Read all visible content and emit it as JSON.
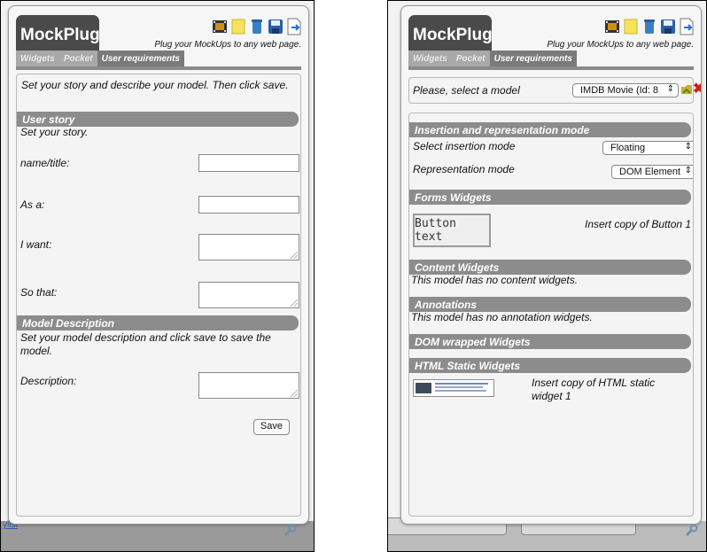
{
  "app": {
    "logo": "MockPlug",
    "tagline": "Plug your MockUps to any web page.",
    "tabs": [
      "Widgets",
      "Pocket",
      "User requirements"
    ]
  },
  "left_panel": {
    "intro": "Set your story and describe your model. Then click save.",
    "user_story": {
      "heading": "User story",
      "subtitle": "Set your story.",
      "fields": [
        {
          "label": "name/title:",
          "value": ""
        },
        {
          "label": "As a:",
          "value": ""
        },
        {
          "label": "I want:",
          "value": ""
        },
        {
          "label": "So that:",
          "value": ""
        }
      ]
    },
    "model_description": {
      "heading": "Model Description",
      "subtitle": "Set your model description and click save to save the model.",
      "field_label": "Description:"
    },
    "save_label": "Save",
    "background_link": "ylist"
  },
  "right_panel": {
    "select_model_label": "Please, select a model",
    "model_select_value": "IMDB Movie (Id: 8",
    "sections": {
      "insertion": "Insertion and representation mode",
      "forms": "Forms Widgets",
      "content": "Content Widgets",
      "annotations": "Annotations",
      "dom": "DOM wrapped Widgets",
      "html_static": "HTML Static Widgets"
    },
    "insertion_mode_label": "Select insertion mode",
    "insertion_mode_value": "Floating",
    "representation_label": "Representation mode",
    "representation_value": "DOM Element",
    "button_widget_text": "Button text",
    "insert_button_text": "Insert copy of Button 1",
    "no_content_text": "This model has no content widgets.",
    "no_annotation_text": "This model has no annotation widgets.",
    "insert_static_text": "Insert copy of HTML static widget 1"
  },
  "icons": [
    "film-icon",
    "note-icon",
    "trash-icon",
    "floppy-disk-icon",
    "export-icon",
    "folder-icon",
    "delete-x-icon",
    "wrench-icon"
  ]
}
